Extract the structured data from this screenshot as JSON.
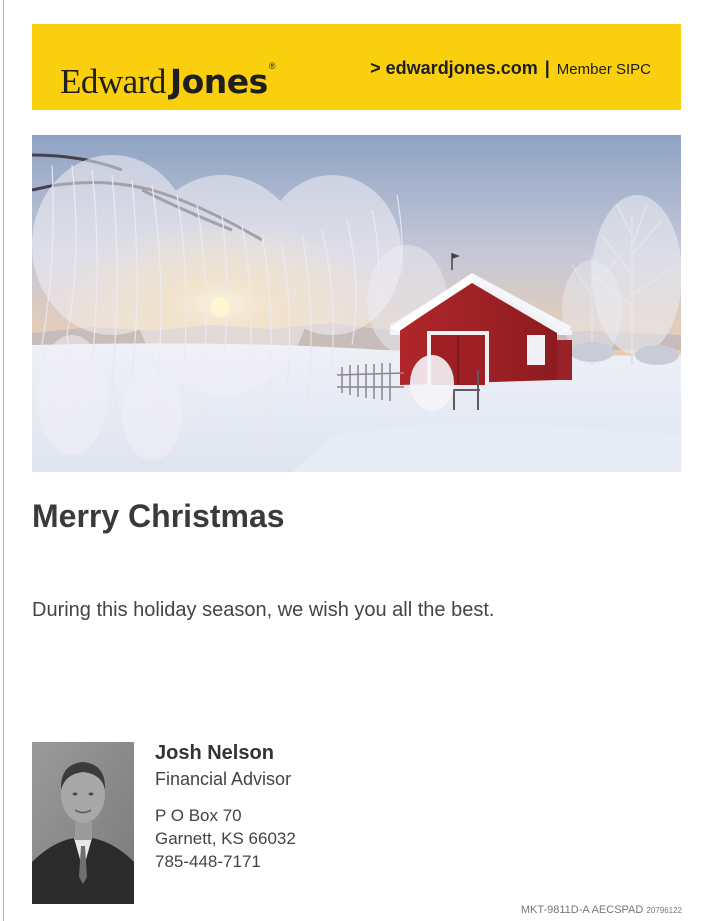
{
  "header": {
    "brand_first": "Edward",
    "brand_second": "Jones",
    "brand_mark": "®",
    "site_link": "> edwardjones.com",
    "separator": "|",
    "member": "Member SIPC",
    "background_color": "#f9cf0e"
  },
  "hero": {
    "icon": "winter-landscape-image"
  },
  "greeting": {
    "title": "Merry Christmas",
    "message": "During this holiday season, we wish you all the best."
  },
  "advisor": {
    "photo_icon": "advisor-portrait",
    "name": "Josh Nelson",
    "title": "Financial Advisor",
    "address_line1": "P O Box 70",
    "address_line2": "Garnett, KS 66032",
    "phone": "785-448-7171"
  },
  "footer": {
    "code": "MKT-9811D-A  AECSPAD",
    "number": "20796122"
  }
}
